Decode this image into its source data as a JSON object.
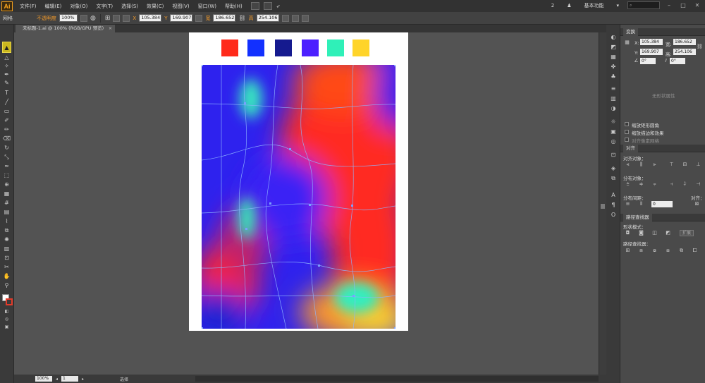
{
  "app": {
    "logo": "Ai",
    "menu": [
      "文件(F)",
      "编辑(E)",
      "对象(O)",
      "文字(T)",
      "选择(S)",
      "效果(C)",
      "视图(V)",
      "窗口(W)",
      "帮助(H)"
    ],
    "user_count": "2",
    "workspace": "基本功能",
    "search_icon": "search-icon"
  },
  "control_bar": {
    "selection_type": "网格",
    "opacity_label": "不透明度",
    "opacity_value": "100%",
    "x_label": "X",
    "x_value": "105.384",
    "y_label": "Y",
    "y_value": "169.907",
    "w_label": "宽",
    "w_value": "186.652",
    "h_label": "高",
    "h_value": "254.106"
  },
  "document": {
    "tab_title": "未标题-1.ai @ 100% (RGB/GPU 预览)",
    "close": "×"
  },
  "swatches": [
    "#ff2a1a",
    "#1230ff",
    "#151a8f",
    "#4c1fff",
    "#2ff0b8",
    "#ffd42a"
  ],
  "status": {
    "zoom": "100%",
    "page": "1",
    "tool": "选择"
  },
  "transform_panel": {
    "tab": "变换",
    "x_label": "X:",
    "x_value": "105.384",
    "y_label": "Y:",
    "y_value": "169.907",
    "w_label": "宽:",
    "w_value": "186.652",
    "h_label": "高:",
    "h_value": "254.106",
    "angle_value": "0°",
    "shear_value": "0°",
    "no_shape": "无形状属性",
    "opt_scale_corners": "缩放矩形圆角",
    "opt_scale_strokes": "缩放描边和效果",
    "opt_pixel_grid": "对齐像素网格"
  },
  "align_panel": {
    "tab": "对齐",
    "align_objects": "对齐对象：",
    "distribute_objects": "分布对象：",
    "distribute_spacing": "分布间距：",
    "align_to": "对齐：",
    "spacing_value": "0"
  },
  "pathfinder_panel": {
    "tab": "路径查找器",
    "shape_modes": "形状模式：",
    "expand": "扩展",
    "pathfinders": "路径查找器："
  }
}
